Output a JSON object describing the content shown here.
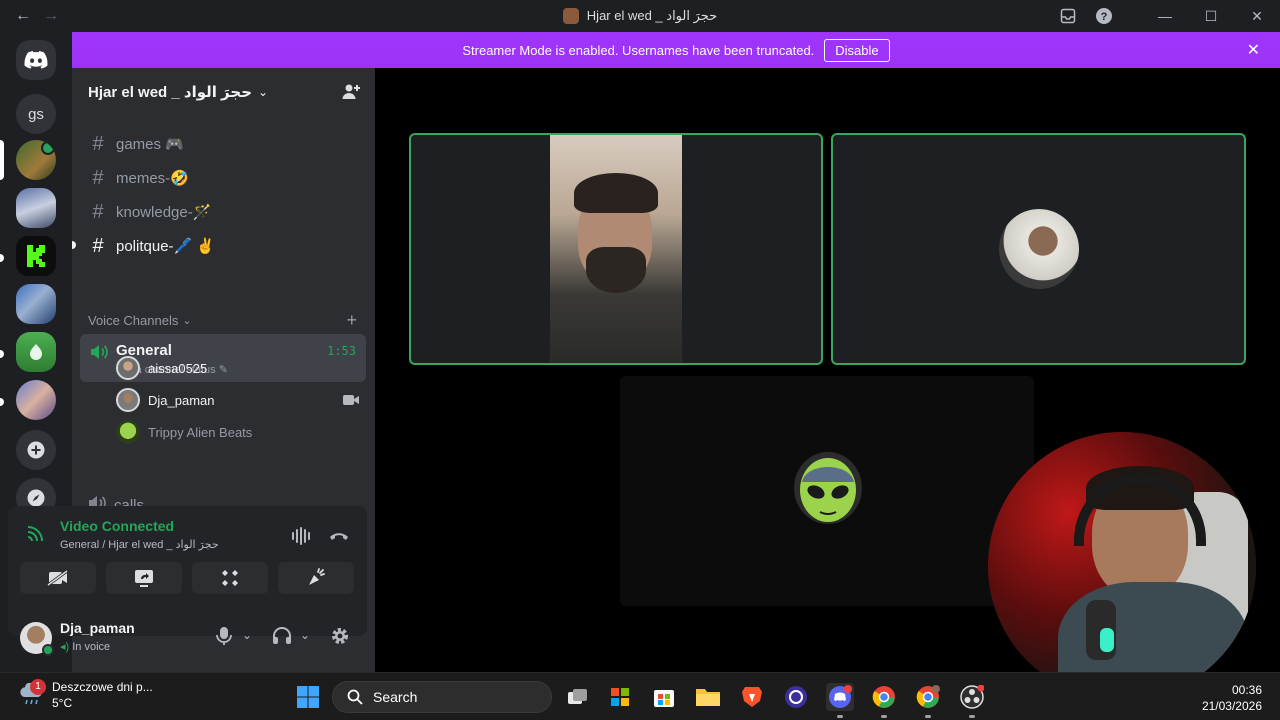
{
  "window": {
    "title": "Hjar el wed _ حجرَ الواد",
    "back_icon": "arrow-left-icon",
    "forward_icon": "arrow-right-icon"
  },
  "banner": {
    "message": "Streamer Mode is enabled. Usernames have been truncated.",
    "button": "Disable"
  },
  "rail": {
    "top_initials": "gs"
  },
  "server": {
    "name": "Hjar el wed _ حجرَ الواد"
  },
  "channels": [
    {
      "name": "games 🎮"
    },
    {
      "name": "memes-🤣"
    },
    {
      "name": "knowledge-🪄"
    },
    {
      "name": "politque-🖊️ ✌️"
    }
  ],
  "voice_category": "Voice Channels",
  "voice_channel": {
    "name": "General",
    "timer": "1:53",
    "status": "Set a channel status"
  },
  "voice_users": [
    {
      "name": "aissa0525"
    },
    {
      "name": "Dja_paman"
    },
    {
      "name": "Trippy Alien Beats"
    }
  ],
  "voice_channel_2": {
    "name": "calls"
  },
  "connection": {
    "title": "Video Connected",
    "subtitle": "General / Hjar el wed _ حجرَ الواد"
  },
  "user": {
    "name": "Dja_paman",
    "status": "In voice"
  },
  "colors": {
    "accent_green": "#23a55a",
    "banner_purple": "#a034fc",
    "tile_border": "#3ba55c"
  },
  "taskbar": {
    "weather_title": "Deszczowe dni p...",
    "weather_temp": "5°C",
    "notification_count": "1",
    "search_placeholder": "Search",
    "time": "00:36",
    "date": "21/03/2026"
  }
}
